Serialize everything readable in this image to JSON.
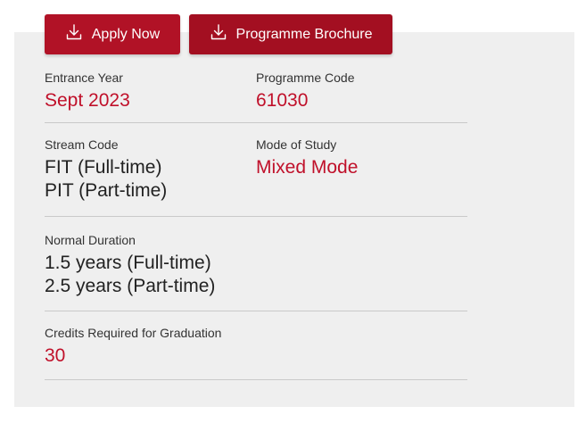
{
  "buttons": {
    "apply_label": "Apply Now",
    "brochure_label": "Programme Brochure",
    "apply_icon": "download-icon",
    "brochure_icon": "download-icon"
  },
  "info": {
    "entrance_year": {
      "label": "Entrance Year",
      "value": "Sept 2023"
    },
    "programme_code": {
      "label": "Programme Code",
      "value": "61030"
    },
    "stream_code": {
      "label": "Stream Code",
      "values": [
        "FIT (Full-time)",
        "PIT (Part-time)"
      ]
    },
    "mode_of_study": {
      "label": "Mode of Study",
      "value": "Mixed Mode"
    },
    "normal_duration": {
      "label": "Normal Duration",
      "values": [
        "1.5 years (Full-time)",
        "2.5 years (Part-time)"
      ]
    },
    "credits": {
      "label": "Credits Required for Graduation",
      "value": "30"
    }
  },
  "colors": {
    "accent": "#c0102a",
    "button_primary": "#b11226",
    "button_secondary": "#a30f21",
    "panel_bg": "#efefef"
  }
}
